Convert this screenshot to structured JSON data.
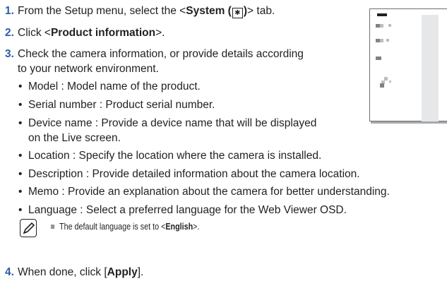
{
  "steps": {
    "s1": {
      "num": "1.",
      "pre": "From the Setup menu, select the <",
      "bold": "System (",
      "gear": "✱",
      "bold2": ")",
      "post": "> tab."
    },
    "s2": {
      "num": "2.",
      "pre": "Click <",
      "bold": "Product information",
      "post": ">."
    },
    "s3": {
      "num": "3.",
      "line1": "Check the camera information, or provide details according",
      "line2": "to your network environment."
    },
    "s4": {
      "num": "4.",
      "pre": "When done, click [",
      "bold": "Apply",
      "post": "]."
    }
  },
  "bullets": [
    {
      "text": "Model : Model name of the product."
    },
    {
      "text": "Serial number : Product serial number."
    },
    {
      "text": "Device name : Provide a device name that will be displayed",
      "cont": "on the Live screen."
    },
    {
      "text": "Location : Specify the location where the camera is installed."
    },
    {
      "text": "Description : Provide detailed information about the camera location."
    },
    {
      "text": "Memo : Provide an explanation about the camera for better understanding."
    },
    {
      "text": "Language : Select a preferred language for the Web Viewer OSD."
    }
  ],
  "bullet_char": "•",
  "note": {
    "pre": "The default language is set to <",
    "bold": "English",
    "post": ">."
  },
  "colors": {
    "step_number": "#2a5ea8",
    "text": "#231f20"
  },
  "icons": {
    "note": "pencil-note-icon",
    "settings": "gear-icon"
  }
}
